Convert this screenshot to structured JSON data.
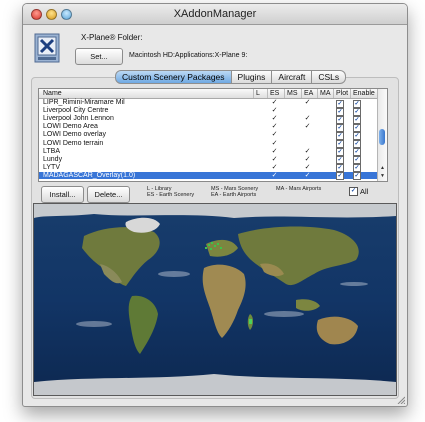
{
  "window": {
    "title": "XAddonManager"
  },
  "folder": {
    "label": "X-Plane® Folder:",
    "set_button": "Set...",
    "path": "Macintosh HD:Applications:X-Plane 9:"
  },
  "tabs": [
    {
      "label": "Custom Scenery Packages",
      "active": true
    },
    {
      "label": "Plugins",
      "active": false
    },
    {
      "label": "Aircraft",
      "active": false
    },
    {
      "label": "CSLs",
      "active": false
    }
  ],
  "table": {
    "columns": {
      "name": "Name",
      "l": "L",
      "es": "ES",
      "ms": "MS",
      "ea": "EA",
      "ma": "MA",
      "plot": "Plot",
      "enable": "Enable"
    },
    "check_glyph": "✓",
    "rows": [
      {
        "name": "LIPR_Rimini-Miramare Mil",
        "es": true,
        "ea": true,
        "plot": true,
        "enable": true,
        "selected": false
      },
      {
        "name": "Liverpool City Centre",
        "es": true,
        "ea": false,
        "plot": true,
        "enable": true,
        "selected": false
      },
      {
        "name": "Liverpool John Lennon",
        "es": true,
        "ea": true,
        "plot": true,
        "enable": true,
        "selected": false
      },
      {
        "name": "LOWI Demo Area",
        "es": true,
        "ea": true,
        "plot": true,
        "enable": true,
        "selected": false
      },
      {
        "name": "LOWI Demo overlay",
        "es": true,
        "ea": false,
        "plot": true,
        "enable": true,
        "selected": false
      },
      {
        "name": "LOWI Demo terrain",
        "es": true,
        "ea": false,
        "plot": true,
        "enable": true,
        "selected": false
      },
      {
        "name": "LTBA",
        "es": true,
        "ea": true,
        "plot": true,
        "enable": true,
        "selected": false
      },
      {
        "name": "Lundy",
        "es": true,
        "ea": true,
        "plot": true,
        "enable": true,
        "selected": false
      },
      {
        "name": "LYTV",
        "es": true,
        "ea": true,
        "plot": true,
        "enable": true,
        "selected": false
      },
      {
        "name": "MADAGASCAR_Overlay(1.0)",
        "es": true,
        "ea": true,
        "plot": true,
        "enable": true,
        "selected": true
      }
    ]
  },
  "buttons": {
    "install": "Install...",
    "delete": "Delete..."
  },
  "legend": {
    "l": "L - Library",
    "es": "ES - Earth Scenery",
    "ms": "MS - Mars Scenery",
    "ea": "EA - Earth Airports",
    "ma": "MA - Mars Airports"
  },
  "all_toggle": {
    "label": "All",
    "checked": true
  },
  "colors": {
    "selection": "#3875d7",
    "ocean": "#0f2f5e",
    "land": "#7f8a46"
  }
}
